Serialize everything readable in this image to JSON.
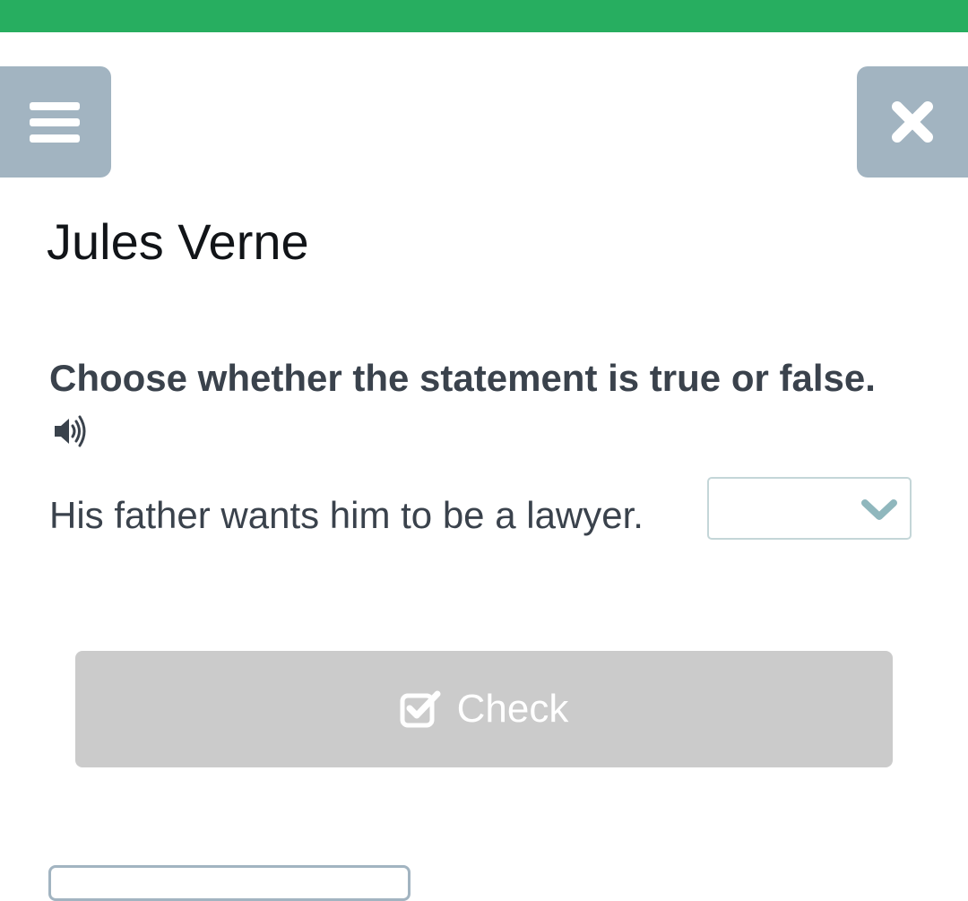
{
  "progress": {
    "fraction": 1.0,
    "color": "#27ae60"
  },
  "header": {
    "menu_icon": "menu-icon",
    "close_icon": "close-icon",
    "button_color": "#a2b4c1"
  },
  "page": {
    "title": "Jules Verne"
  },
  "exercise": {
    "instruction": "Choose whether the statement is true or false.",
    "audio_icon": "speaker-icon",
    "statement": "His father wants him to be a lawyer.",
    "answer_value": ""
  },
  "actions": {
    "check_label": "Check",
    "check_icon": "checkbox-check-icon"
  }
}
